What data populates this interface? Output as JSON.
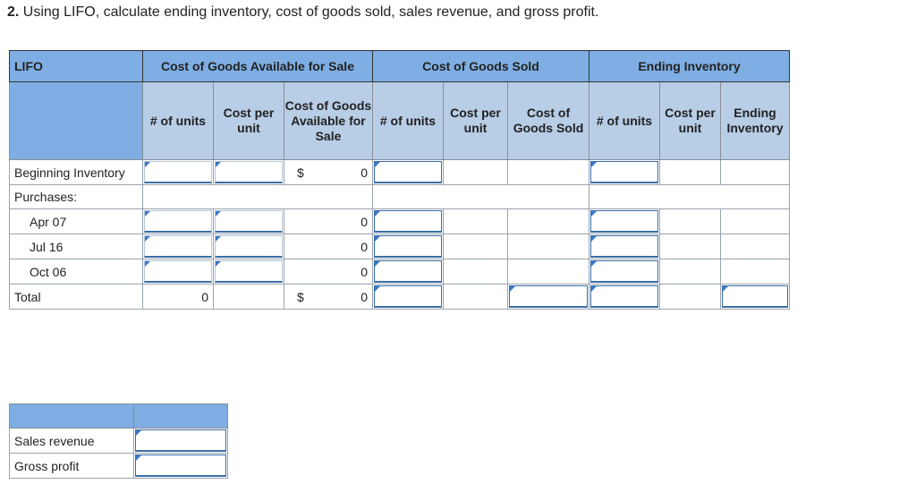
{
  "question": {
    "number": "2.",
    "text": "Using LIFO, calculate ending inventory, cost of goods sold, sales revenue, and gross profit."
  },
  "lifo_table": {
    "corner_label": "LIFO",
    "groups": {
      "available": "Cost of Goods Available for Sale",
      "sold": "Cost of Goods Sold",
      "ending": "Ending Inventory"
    },
    "subheaders": {
      "available": [
        "# of units",
        "Cost per unit",
        "Cost of Goods Available for Sale"
      ],
      "sold": [
        "# of units",
        "Cost per unit",
        "Cost of Goods Sold"
      ],
      "ending": [
        "# of units",
        "Cost per unit",
        "Ending Inventory"
      ]
    },
    "rows": {
      "beginning": {
        "label": "Beginning Inventory",
        "currency": "$",
        "cogas": "0"
      },
      "purchases": {
        "label": "Purchases:"
      },
      "apr": {
        "label": "Apr 07",
        "cogas": "0"
      },
      "jul": {
        "label": "Jul 16",
        "cogas": "0"
      },
      "oct": {
        "label": "Oct 06",
        "cogas": "0"
      },
      "total": {
        "label": "Total",
        "units": "0",
        "currency": "$",
        "cogas": "0"
      }
    }
  },
  "summary_table": {
    "rows": [
      "Sales revenue",
      "Gross profit"
    ]
  },
  "colors": {
    "header": "#7eaee3",
    "subheader": "#b8cde6",
    "input_marker": "#3a79c9"
  }
}
